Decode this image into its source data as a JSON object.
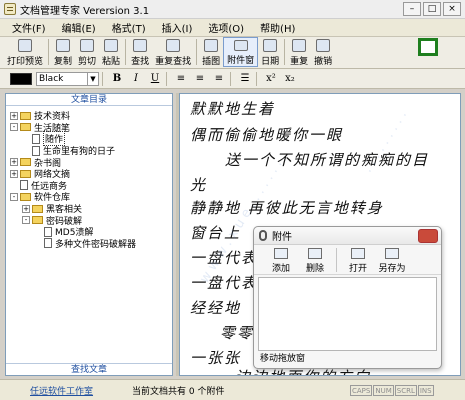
{
  "window": {
    "title": "文档管理专家 Verersion 3.1"
  },
  "menu": [
    "文件(F)",
    "编辑(E)",
    "格式(T)",
    "插入(I)",
    "选项(O)",
    "帮助(H)"
  ],
  "toolbar": {
    "print_preview": "打印预览",
    "copy": "复制",
    "cut": "剪切",
    "paste": "粘贴",
    "find": "查找",
    "replace": "重复查找",
    "image": "插图",
    "attachment": "附件窗",
    "date": "日期",
    "redo": "重复",
    "undo": "撤销"
  },
  "format": {
    "color_name": "Black",
    "bold": "B",
    "italic": "I",
    "underline": "U",
    "sup": "x²",
    "sub": "x₂"
  },
  "tree": {
    "title": "文章目录",
    "footer": "查找文章",
    "nodes": [
      {
        "label": "技术资料",
        "level": 0,
        "kind": "folder",
        "exp": "+"
      },
      {
        "label": "生活随笔",
        "level": 0,
        "kind": "folder",
        "exp": "-"
      },
      {
        "label": "随作",
        "level": 1,
        "kind": "doc",
        "selected": true
      },
      {
        "label": "生命里有狗的日子",
        "level": 1,
        "kind": "doc"
      },
      {
        "label": "杂书阁",
        "level": 0,
        "kind": "folder",
        "exp": "+"
      },
      {
        "label": "网络文摘",
        "level": 0,
        "kind": "folder",
        "exp": "+"
      },
      {
        "label": "任远商务",
        "level": 0,
        "kind": "doc"
      },
      {
        "label": "软件仓库",
        "level": 0,
        "kind": "folder",
        "exp": "-"
      },
      {
        "label": "黑客相关",
        "level": 1,
        "kind": "folder",
        "exp": "+"
      },
      {
        "label": "密码破解",
        "level": 1,
        "kind": "folder",
        "exp": "-"
      },
      {
        "label": "MD5溃解",
        "level": 2,
        "kind": "doc"
      },
      {
        "label": "多种文件密码破解器",
        "level": 2,
        "kind": "doc"
      }
    ]
  },
  "editor": {
    "lines": [
      "默默地生着",
      "偶而偷偷地暖你一眼",
      "送一个不知所谓的痴痴的目",
      "光",
      "静静地   再彼此无言地转身",
      "窗台上",
      "一盘代表",
      "一盘代表",
      "经经地",
      "零零",
      "一张张",
      "边边地面你的方向"
    ]
  },
  "attach": {
    "title": "附件",
    "add": "添加",
    "delete": "删除",
    "open": "打开",
    "save_as": "另存为",
    "footer": "移动拖放窗"
  },
  "status": {
    "studio": "任远软件工作室",
    "info": "当前文档共有 0 个附件",
    "indicators": [
      "CAPS",
      "NUM",
      "SCRL",
      "INS"
    ]
  }
}
